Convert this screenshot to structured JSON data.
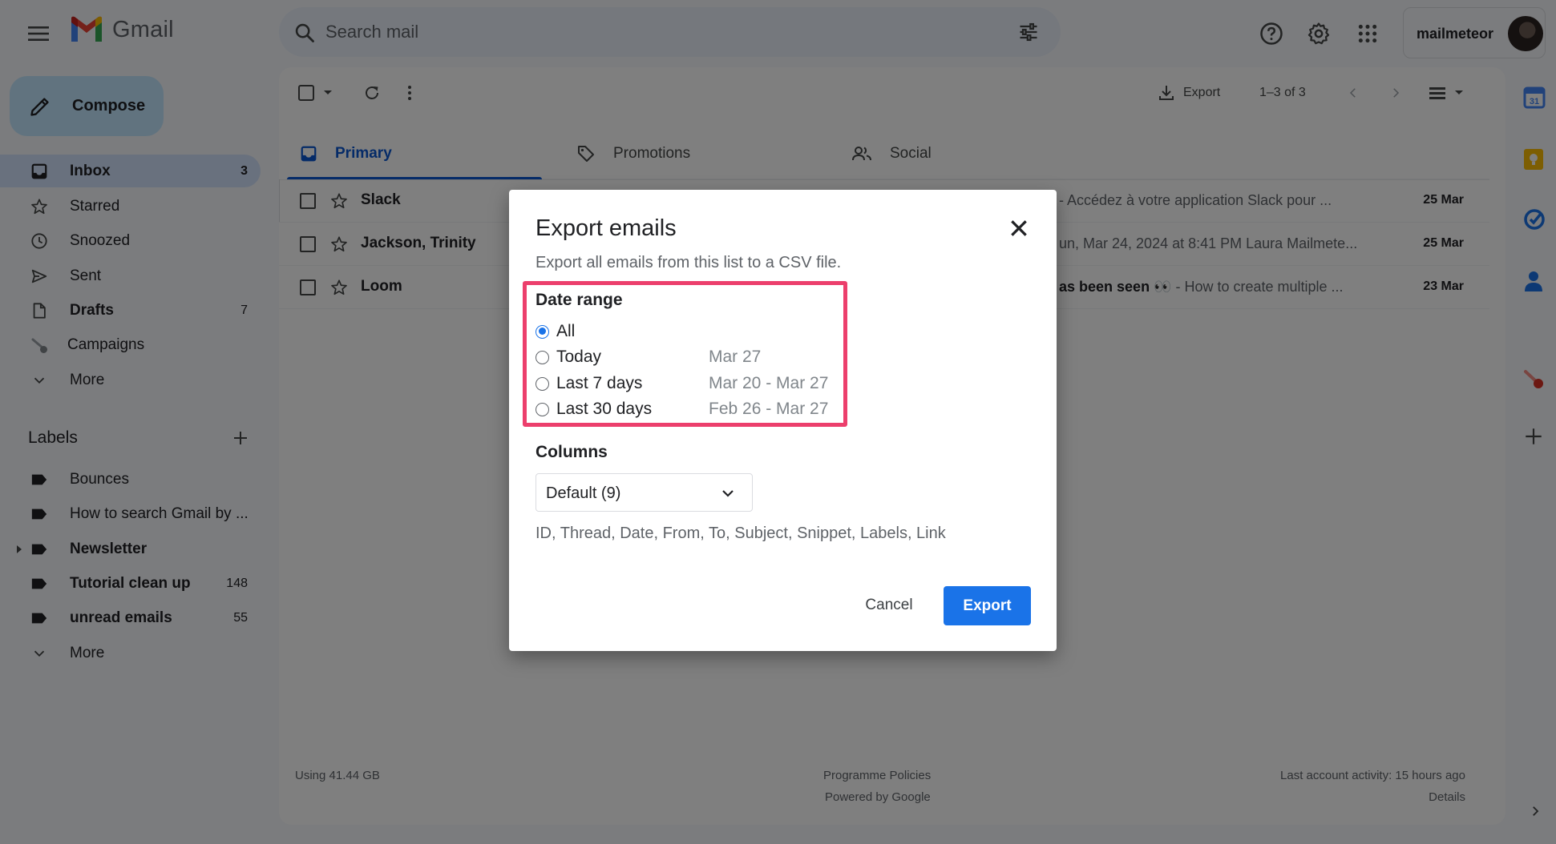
{
  "header": {
    "app_name": "Gmail",
    "search_placeholder": "Search mail",
    "account_name": "mailmeteor"
  },
  "compose": {
    "label": "Compose"
  },
  "nav": {
    "items": [
      {
        "label": "Inbox",
        "count": "3",
        "bold": true,
        "active": true
      },
      {
        "label": "Starred",
        "count": ""
      },
      {
        "label": "Snoozed",
        "count": ""
      },
      {
        "label": "Sent",
        "count": ""
      },
      {
        "label": "Drafts",
        "count": "7",
        "bold": true
      },
      {
        "label": "Campaigns",
        "count": ""
      },
      {
        "label": "More",
        "count": ""
      }
    ]
  },
  "labels": {
    "heading": "Labels",
    "items": [
      {
        "label": "Bounces",
        "count": ""
      },
      {
        "label": "How to search Gmail by ...",
        "count": ""
      },
      {
        "label": "Newsletter",
        "count": "",
        "bold": true
      },
      {
        "label": "Tutorial clean up",
        "count": "148",
        "bold": true
      },
      {
        "label": "unread emails",
        "count": "55",
        "bold": true
      }
    ],
    "more": "More"
  },
  "toolbar": {
    "export_label": "Export",
    "pagination": "1–3 of 3"
  },
  "tabs": [
    {
      "label": "Primary",
      "active": true
    },
    {
      "label": "Promotions"
    },
    {
      "label": "Social"
    }
  ],
  "emails": [
    {
      "sender": "Slack",
      "snippet_bold": "",
      "snippet": "- Accédez à votre application Slack pour ...",
      "date": "25 Mar"
    },
    {
      "sender": "Jackson, Trinity",
      "snippet_bold": "",
      "snippet": "un, Mar 24, 2024 at 8:41 PM Laura Mailmete...",
      "date": "25 Mar"
    },
    {
      "sender": "Loom",
      "snippet_bold": "as been seen 👀",
      "snippet": " - How to create multiple ...",
      "date": "23 Mar"
    }
  ],
  "footer": {
    "storage": "Using 41.44 GB",
    "policies": "Programme Policies",
    "powered": "Powered by Google",
    "activity": "Last account activity: 15 hours ago",
    "details": "Details"
  },
  "dialog": {
    "title": "Export emails",
    "subtitle": "Export all emails from this list to a CSV file.",
    "date_range_title": "Date range",
    "options": [
      {
        "label": "All",
        "range": "",
        "checked": true
      },
      {
        "label": "Today",
        "range": "Mar 27"
      },
      {
        "label": "Last 7 days",
        "range": "Mar 20 - Mar 27"
      },
      {
        "label": "Last 30 days",
        "range": "Feb 26 - Mar 27"
      }
    ],
    "columns_title": "Columns",
    "columns_select": "Default (9)",
    "columns_list": "ID, Thread, Date, From, To, Subject, Snippet, Labels, Link",
    "cancel_label": "Cancel",
    "export_label": "Export"
  },
  "colors": {
    "accent": "#1a73e8",
    "highlight": "#ec3f6c",
    "compose_bg": "#c2e7ff",
    "active_nav": "#d3e3fd"
  }
}
